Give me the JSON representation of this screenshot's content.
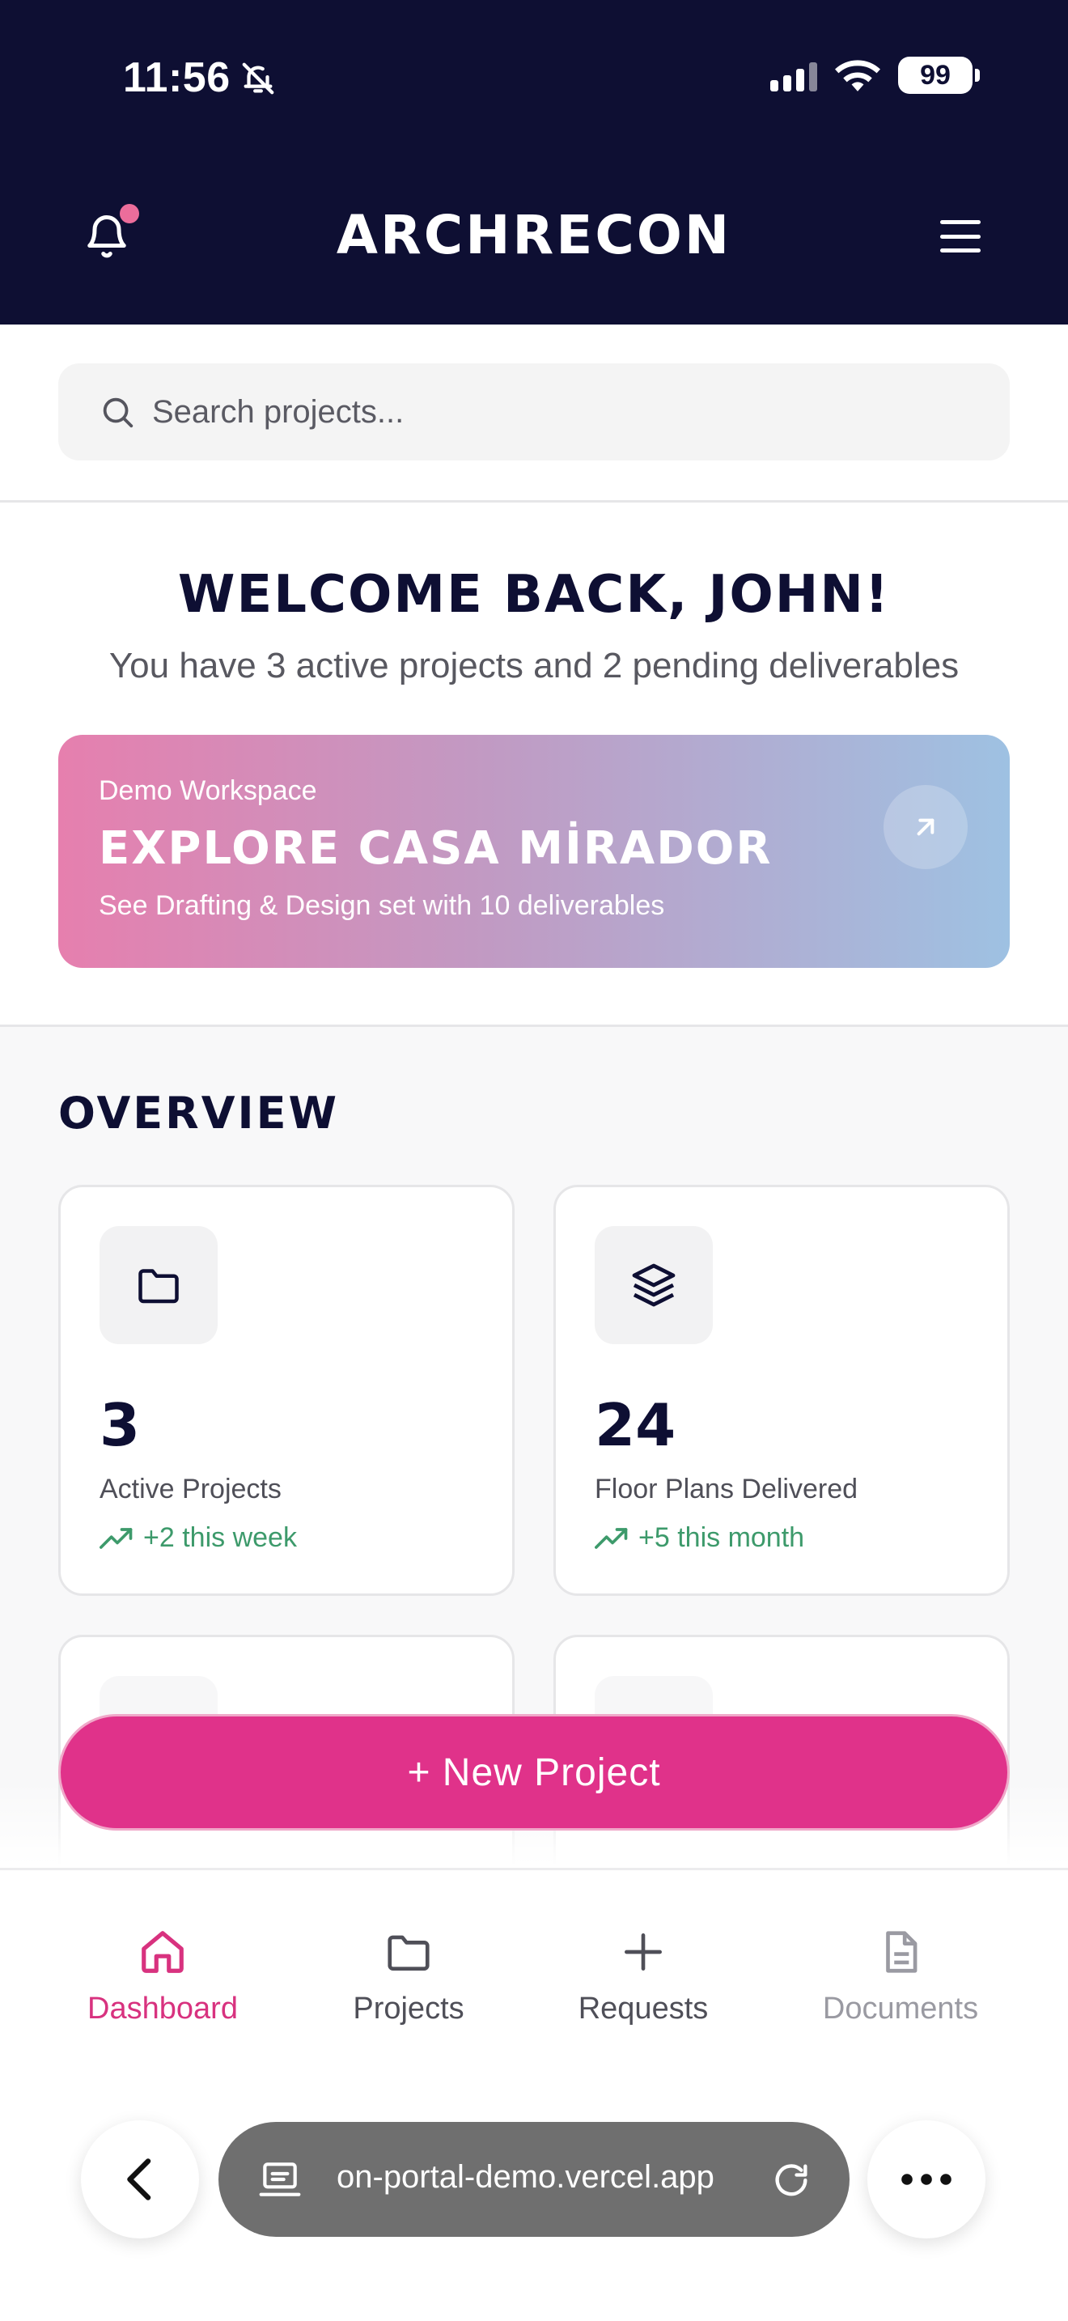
{
  "status_bar": {
    "time": "11:56",
    "battery": "99"
  },
  "header": {
    "brand": "ARCHRECON"
  },
  "search": {
    "placeholder": "Search projects..."
  },
  "welcome": {
    "title": "WELCOME BACK, JOHN!",
    "subtitle": "You have 3 active projects and 2 pending deliverables"
  },
  "banner": {
    "kicker": "Demo Workspace",
    "title": "EXPLORE CASA MİRADOR",
    "description": "See Drafting & Design set with 10 deliverables"
  },
  "overview": {
    "title": "OVERVIEW",
    "cards": [
      {
        "icon": "folder-icon",
        "value": "3",
        "label": "Active Projects",
        "trend": "+2 this week"
      },
      {
        "icon": "layers-icon",
        "value": "24",
        "label": "Floor Plans Delivered",
        "trend": "+5 this month"
      }
    ]
  },
  "actions": {
    "new_project": "+ New Project"
  },
  "tabbar": {
    "items": [
      {
        "label": "Dashboard",
        "icon": "home-icon",
        "state": "active"
      },
      {
        "label": "Projects",
        "icon": "folder-icon",
        "state": "normal"
      },
      {
        "label": "Requests",
        "icon": "plus-icon",
        "state": "normal"
      },
      {
        "label": "Documents",
        "icon": "document-icon",
        "state": "disabled"
      }
    ]
  },
  "browser": {
    "url": "on-portal-demo.vercel.app"
  },
  "colors": {
    "header_bg": "#0e0f33",
    "accent": "#e0328a",
    "trend": "#3d9a6b"
  }
}
